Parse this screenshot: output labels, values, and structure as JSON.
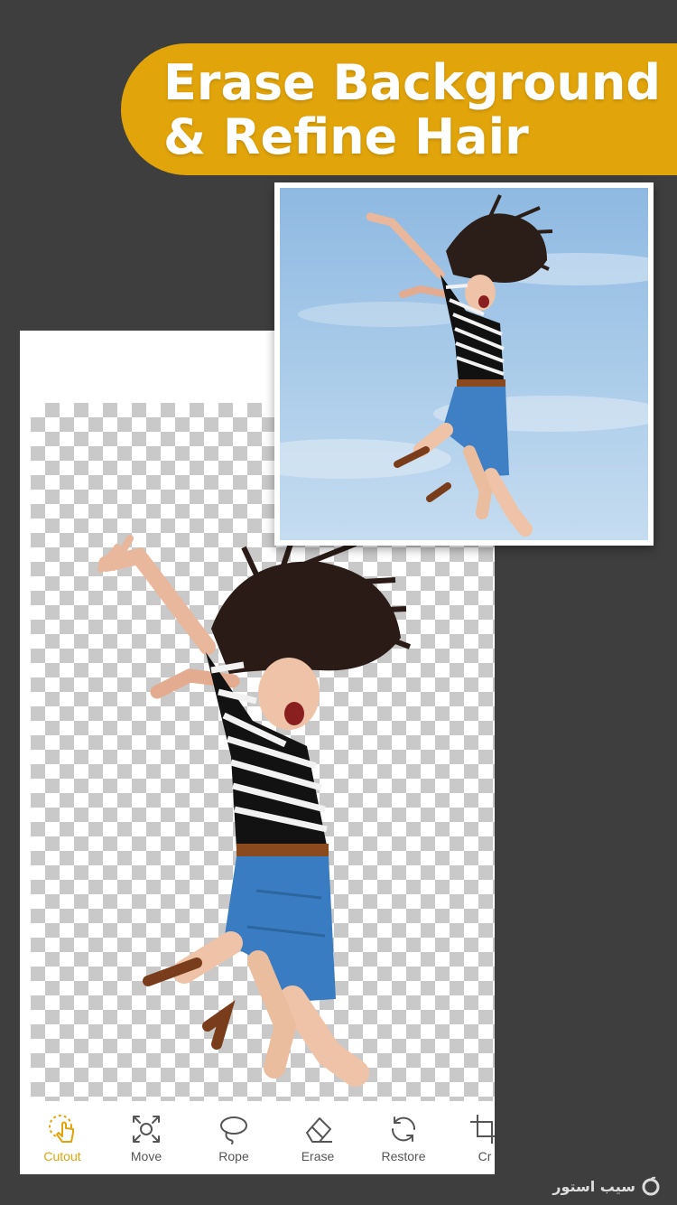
{
  "banner": {
    "line1": "Erase Background",
    "line2": "& Refine Hair"
  },
  "colors": {
    "accent": "#e1a40b",
    "background": "#3e3e3e",
    "checker": "#c9c9c9"
  },
  "toolbar": {
    "tools": [
      {
        "label": "Cutout",
        "icon": "hand-select-icon",
        "active": true
      },
      {
        "label": "Move",
        "icon": "move-arrows-icon",
        "active": false
      },
      {
        "label": "Rope",
        "icon": "lasso-icon",
        "active": false
      },
      {
        "label": "Erase",
        "icon": "eraser-icon",
        "active": false
      },
      {
        "label": "Restore",
        "icon": "restore-arrows-icon",
        "active": false
      },
      {
        "label": "Cr",
        "icon": "crop-icon",
        "active": false
      }
    ]
  },
  "watermark": {
    "text": "سیب استور",
    "icon": "apple-logo-icon"
  }
}
